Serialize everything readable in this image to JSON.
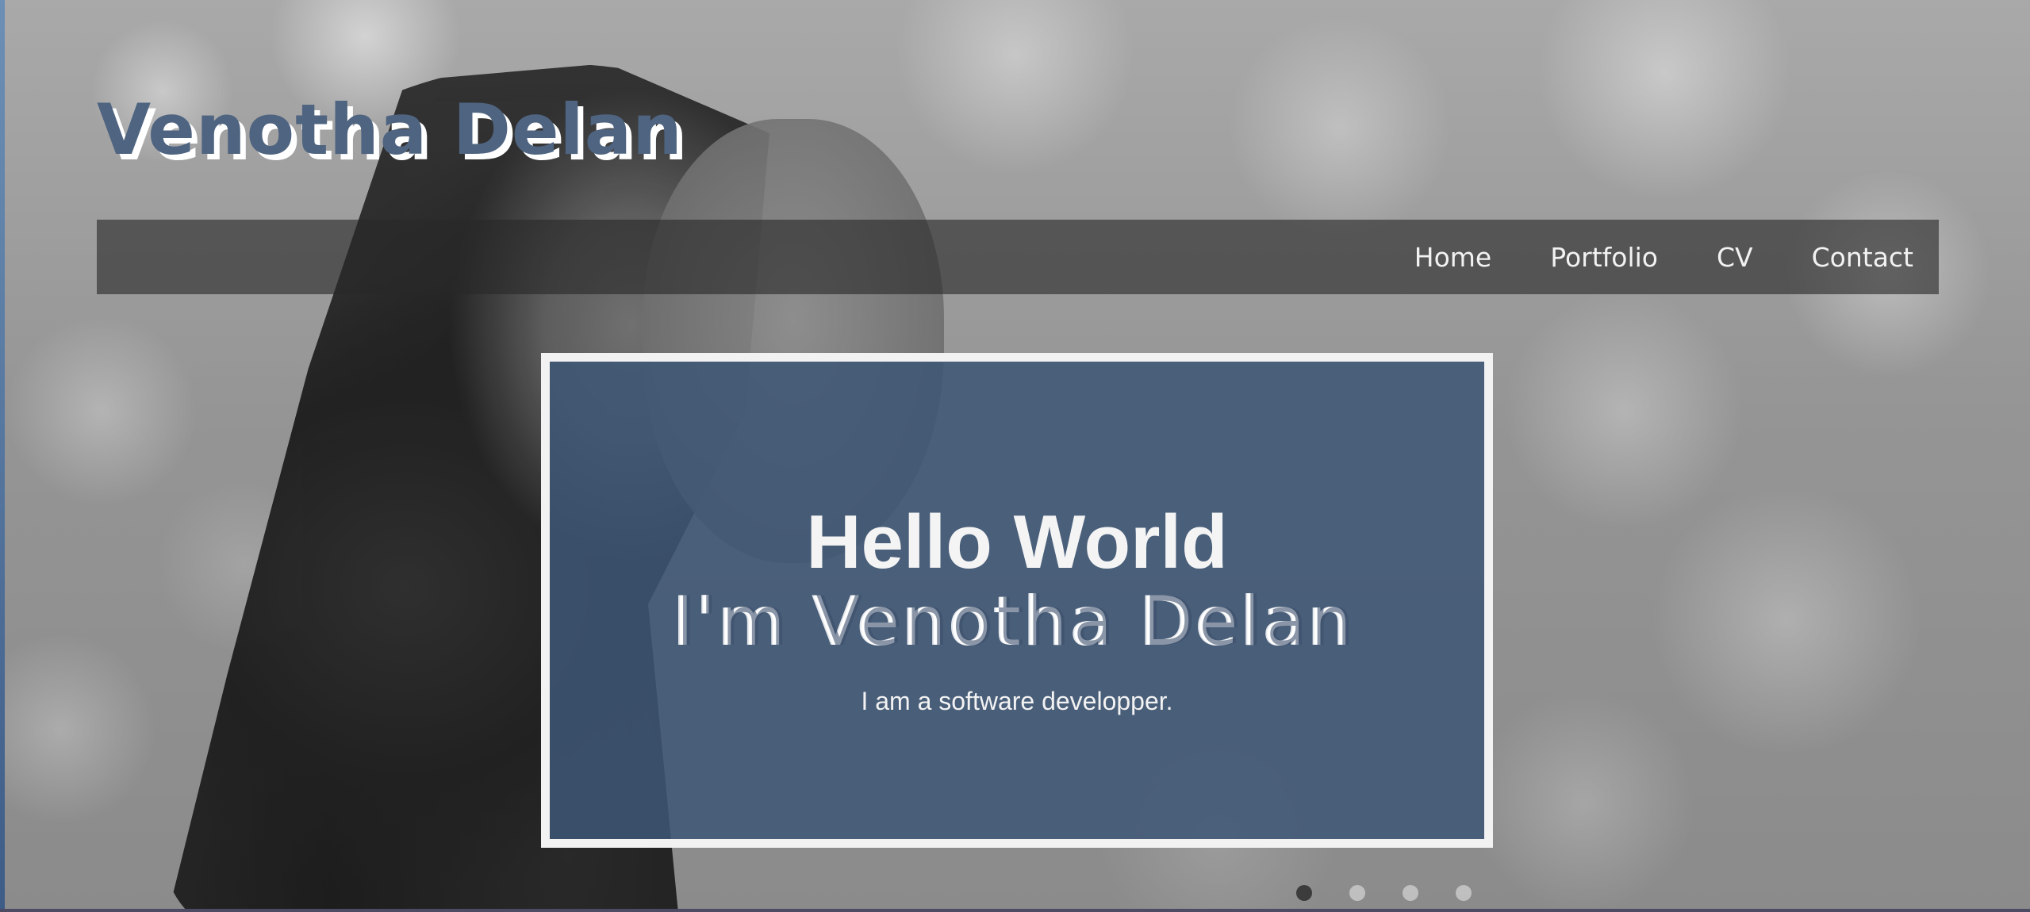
{
  "site": {
    "title": "Venotha Delan"
  },
  "nav": {
    "items": [
      {
        "label": "Home"
      },
      {
        "label": "Portfolio"
      },
      {
        "label": "CV"
      },
      {
        "label": "Contact"
      }
    ]
  },
  "hero": {
    "heading": "Hello World",
    "name_line": "I'm Venotha Delan",
    "subtitle": "I am a software developper."
  },
  "carousel": {
    "slide_count": 4,
    "active_index": 0
  },
  "colors": {
    "title": "#4f6480",
    "hero_panel": "#3e5676",
    "nav_bar": "#282828",
    "frame_border": "#f2f2f2"
  }
}
